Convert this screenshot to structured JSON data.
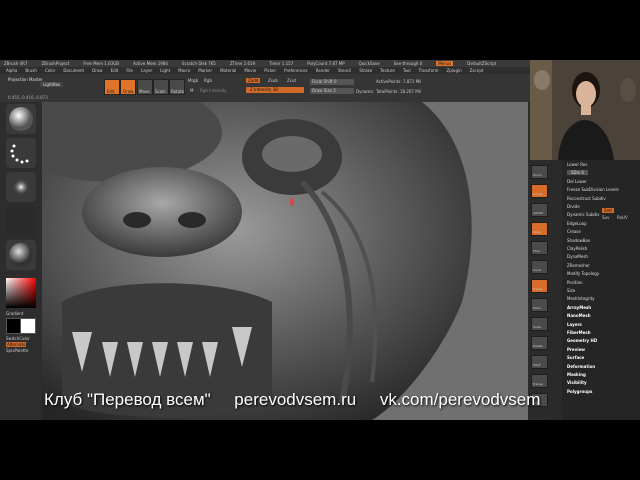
{
  "app": {
    "title_items": [
      "ZBrush 4R7",
      "ZBrushProject",
      "Free Mem 1.63GB",
      "Active Mem 1984",
      "Scratch Disk 765",
      "ZTime 2.619",
      "Timer 1.157",
      "PolyCount 7.87 MP",
      "QuickSave",
      "See-through 0",
      "Menus",
      "DefaultZScript"
    ]
  },
  "menubar": {
    "items": [
      "Alpha",
      "Brush",
      "Color",
      "Document",
      "Draw",
      "Edit",
      "File",
      "Layer",
      "Light",
      "Macro",
      "Marker",
      "Material",
      "Movie",
      "Picker",
      "Preferences",
      "Render",
      "Stencil",
      "Stroke",
      "Texture",
      "Tool",
      "Transform",
      "Zplugin",
      "Zscript"
    ]
  },
  "toolbar": {
    "left_label_1": "Projection Master",
    "left_label_2": "LightBox",
    "coords": "0.455,-0.416,-0.873",
    "edit_label": "Edit",
    "draw_label": "Draw",
    "move_label": "Move",
    "scale_label": "Scale",
    "rotate_label": "Rotate",
    "mrgb_label": "Mrgb",
    "rgb_label": "Rgb",
    "m_label": "M",
    "rgb_intensity_label": "Rgb Intensity",
    "zadd_label": "Zadd",
    "zsub_label": "Zsub",
    "zcut_label": "Zcut",
    "z_intensity_label": "Z Intensity 38",
    "focal_shift_label": "Focal Shift 0",
    "draw_size_label": "Draw Size 2",
    "dynamic_label": "Dynamic",
    "active_points_label": "ActivePoints: 7.871 Mil",
    "total_points_label": "TotalPoints: 18.207 Mil"
  },
  "leftshelf": {
    "gradient_label": "Gradient",
    "switch_color_label": "SwitchColor",
    "alternate_label": "Alternate",
    "spix_label": "SpixPalette"
  },
  "rightshelf": {
    "items": [
      "BPR",
      "SPix 3",
      "Scroll",
      "Zoom",
      "Actual",
      "AAHalf",
      "Persp",
      "Floor",
      "Local",
      "Frame",
      "Move",
      "Scale",
      "Rotate",
      "PolyF",
      "Transp",
      "Solo"
    ]
  },
  "panel": {
    "items": [
      {
        "label": "Lower Res",
        "header": false
      },
      {
        "label": "SDiv 6",
        "header": false
      },
      {
        "label": "Del Lower",
        "header": false
      },
      {
        "label": "Freeze SubDivision Levels",
        "header": false
      },
      {
        "label": "Reconstruct Subdiv",
        "header": false
      },
      {
        "label": "Divide",
        "header": false
      },
      {
        "label": "Dynamic Subdiv",
        "header": false
      },
      {
        "label": "EdgeLoop",
        "header": false
      },
      {
        "label": "Crease",
        "header": false
      },
      {
        "label": "ShadowBox",
        "header": false
      },
      {
        "label": "ClayPolish",
        "header": false
      },
      {
        "label": "DynaMesh",
        "header": false
      },
      {
        "label": "ZRemesher",
        "header": false
      },
      {
        "label": "Modify Topology",
        "header": false
      },
      {
        "label": "Position",
        "header": false
      },
      {
        "label": "Size",
        "header": false
      },
      {
        "label": "MeshIntegrity",
        "header": false
      },
      {
        "label": "ArrayMesh",
        "header": true
      },
      {
        "label": "NanoMesh",
        "header": true
      },
      {
        "label": "Layers",
        "header": true
      },
      {
        "label": "FiberMesh",
        "header": true
      },
      {
        "label": "Geometry HD",
        "header": true
      },
      {
        "label": "Preview",
        "header": true
      },
      {
        "label": "Surface",
        "header": true
      },
      {
        "label": "Deformation",
        "header": true
      },
      {
        "label": "Masking",
        "header": true
      },
      {
        "label": "Visibility",
        "header": true
      },
      {
        "label": "Polygroups",
        "header": true
      }
    ],
    "smt_label": "Smt",
    "suv_label": "Suv",
    "reuv_label": "ReUV"
  },
  "watermark": {
    "club": "Клуб \"Перевод всем\"",
    "site": "perevodvsem.ru",
    "vk": "vk.com/perevodvsem"
  },
  "colors": {
    "accent": "#e0742a",
    "ui_dark": "#2a2a2a",
    "viewport_bg": "#6e6e6e",
    "watermark_text": "#ffffff"
  }
}
